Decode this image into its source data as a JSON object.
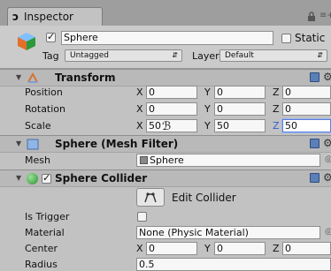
{
  "tab": {
    "glyph": "ɔ",
    "label": "Inspector"
  },
  "tabbar": {
    "menu_glyph": "≡+"
  },
  "object": {
    "active": true,
    "name": "Sphere",
    "static_label": "Static",
    "static_checked": false,
    "tag_label": "Tag",
    "tag_value": "Untagged",
    "layer_label": "Layer",
    "layer_value": "Default"
  },
  "transform": {
    "title": "Transform",
    "rows": [
      {
        "label": "Position",
        "x": "0",
        "y": "0",
        "z": "0"
      },
      {
        "label": "Rotation",
        "x": "0",
        "y": "0",
        "z": "0"
      },
      {
        "label": "Scale",
        "x": "50",
        "y": "50",
        "z": "50"
      }
    ],
    "axis": {
      "x": "X",
      "y": "Y",
      "z": "Z"
    }
  },
  "mesh_filter": {
    "title": "Sphere (Mesh Filter)",
    "mesh_label": "Mesh",
    "mesh_value": "Sphere"
  },
  "sphere_collider": {
    "title": "Sphere Collider",
    "enabled": true,
    "edit_label": "Edit Collider",
    "is_trigger_label": "Is Trigger",
    "is_trigger": false,
    "material_label": "Material",
    "material_value": "None (Physic Material)",
    "center_label": "Center",
    "center": {
      "x": "0",
      "y": "0",
      "z": "0"
    },
    "radius_label": "Radius",
    "radius_value": "0.5"
  },
  "colors": {
    "panel": "#c2c2c2",
    "section_header": "#b9b9b9",
    "field": "#f7f7f7",
    "focus": "#5a7fd8",
    "transform_icon": "#d9732f",
    "collider_icon": "#3aa23a",
    "mesh_icon": "#5b7fb6"
  }
}
